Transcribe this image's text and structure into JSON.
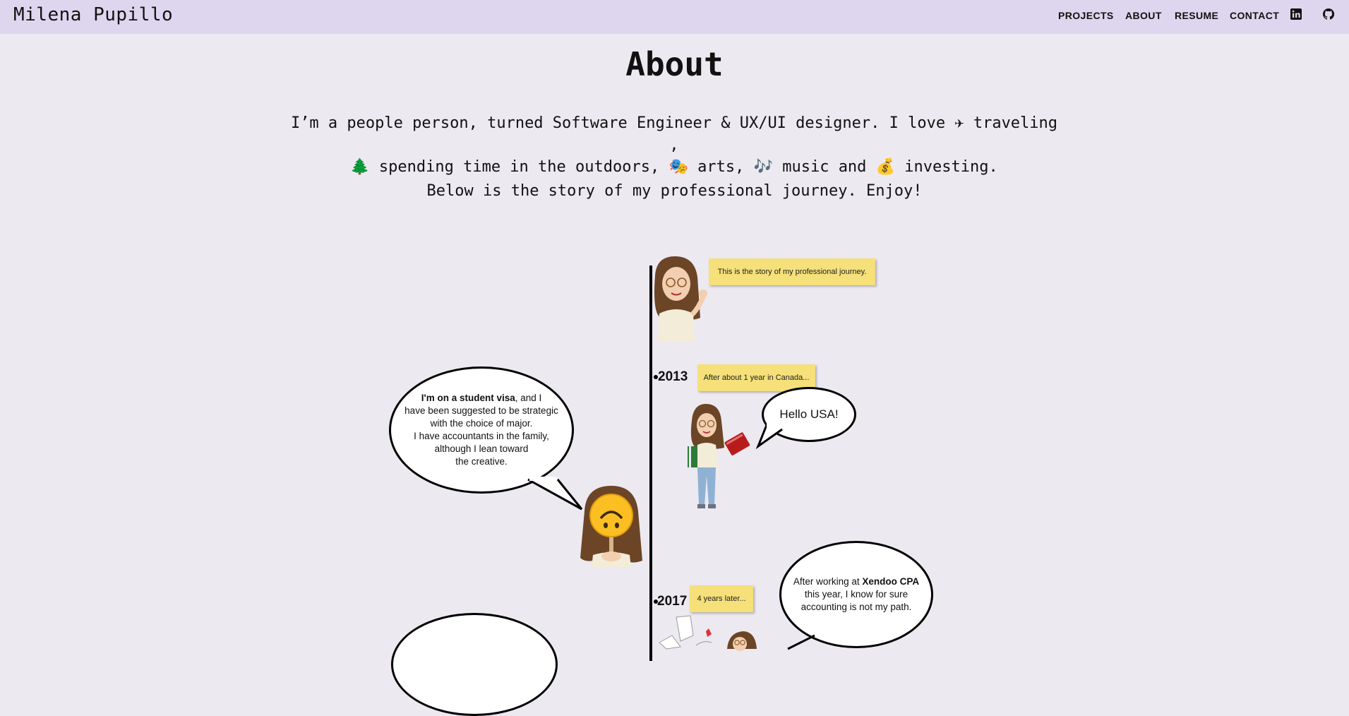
{
  "header": {
    "brand": "Milena Pupillo",
    "nav": [
      {
        "label": "PROJECTS"
      },
      {
        "label": "ABOUT"
      },
      {
        "label": "RESUME"
      },
      {
        "label": "CONTACT"
      }
    ],
    "icons": [
      "linkedin-icon",
      "github-icon"
    ]
  },
  "about": {
    "title": "About",
    "intro_line1": "I’m a people person, turned Software Engineer & UX/UI designer. I love ✈ traveling ,",
    "intro_line2": "🌲 spending time in the outdoors, 🎭 arts, 🎶 music and 💰 investing.",
    "below": "Below is the story of my professional journey. Enjoy!"
  },
  "timeline": {
    "intro_note": "This is the story of my professional journey.",
    "y2013": {
      "year": "2013",
      "note": "After about 1 year in Canada...",
      "bubble_right": "Hello USA!",
      "bubble_left_bold": "I'm on a student visa",
      "bubble_left_rest1": ", and I",
      "bubble_left_line2": "have been suggested to be strategic",
      "bubble_left_line3": "with the choice of major.",
      "bubble_left_line4": "I have accountants in the family,",
      "bubble_left_line5": "although I lean toward",
      "bubble_left_line6": "the creative."
    },
    "y2017": {
      "year": "2017",
      "note": "4  years later...",
      "bubble_pre": "After working at ",
      "bubble_bold": "Xendoo CPA",
      "bubble_line2": "this year, I know for sure",
      "bubble_line3": "accounting is not my path."
    }
  },
  "colors": {
    "header_bg": "#ded6ee",
    "page_bg": "#ece9f1",
    "note_bg": "#f5e07a"
  }
}
